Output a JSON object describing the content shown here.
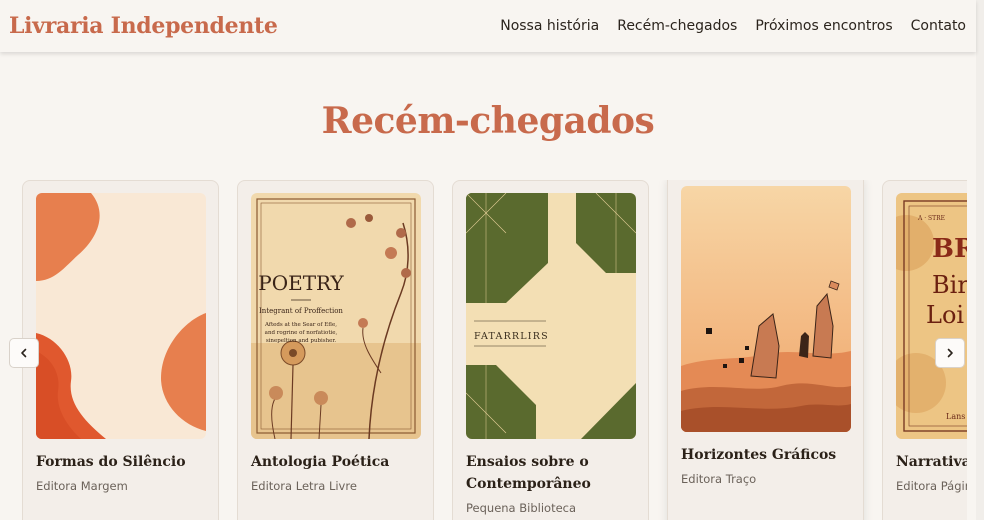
{
  "header": {
    "brand": "Livraria Independente",
    "nav": [
      "Nossa história",
      "Recém-chegados",
      "Próximos encontros",
      "Contato"
    ]
  },
  "section": {
    "title": "Recém-chegados"
  },
  "books": [
    {
      "title": "Formas do Silêncio",
      "publisher": "Editora Margem"
    },
    {
      "title": "Antologia Poética",
      "publisher": "Editora Letra Livre",
      "cover_title": "POETRY",
      "cover_subtitle": "Integrant of Proffection",
      "cover_text_1": "Afteds at the Sear of Efle,",
      "cover_text_2": "and rogrine of norfatiotie,",
      "cover_text_3": "sinepeltion and pubisher."
    },
    {
      "title": "Ensaios sobre o Contemporâneo",
      "publisher": "Pequena Biblioteca",
      "cover_title": "FATARRLIRS"
    },
    {
      "title": "Horizontes Gráficos",
      "publisher": "Editora Traço"
    },
    {
      "title": "Narrativas",
      "publisher": "Editora Página",
      "cover_top": "A · STRE",
      "cover_title": "BR",
      "cover_line_2": "Bir",
      "cover_line_3": "Loi",
      "cover_bottom": "Lans"
    }
  ],
  "controls": {
    "prev_icon": "chevron-left-icon",
    "next_icon": "chevron-right-icon"
  },
  "colors": {
    "accent": "#c86a4c",
    "background": "#f8f5f1",
    "card": "#f3eee9",
    "olive": "#5a6a2e"
  }
}
